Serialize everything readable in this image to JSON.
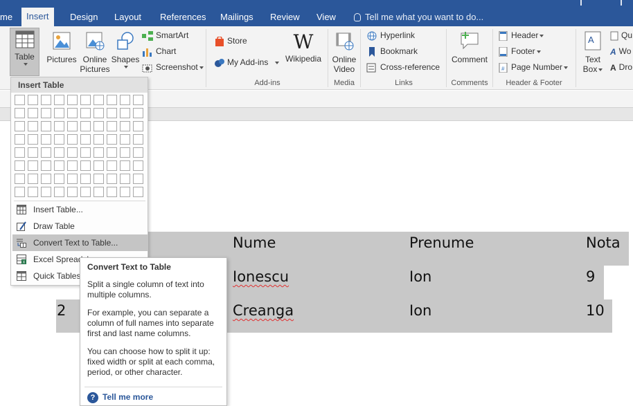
{
  "tabs": [
    {
      "label": "me",
      "active": false
    },
    {
      "label": "Insert",
      "active": true
    },
    {
      "label": "Design",
      "active": false
    },
    {
      "label": "Layout",
      "active": false
    },
    {
      "label": "References",
      "active": false
    },
    {
      "label": "Mailings",
      "active": false
    },
    {
      "label": "Review",
      "active": false
    },
    {
      "label": "View",
      "active": false
    }
  ],
  "tell_me": "Tell me what you want to do...",
  "ribbon": {
    "table": "Table",
    "pictures": "Pictures",
    "online_pictures_1": "Online",
    "online_pictures_2": "Pictures",
    "shapes": "Shapes",
    "smartart": "SmartArt",
    "chart": "Chart",
    "screenshot": "Screenshot",
    "store": "Store",
    "my_addins": "My Add-ins",
    "wikipedia": "Wikipedia",
    "addins_group": "Add-ins",
    "online_video_1": "Online",
    "online_video_2": "Video",
    "media_group": "Media",
    "hyperlink": "Hyperlink",
    "bookmark": "Bookmark",
    "cross_reference": "Cross-reference",
    "links_group": "Links",
    "comment": "Comment",
    "comments_group": "Comments",
    "header": "Header",
    "footer": "Footer",
    "page_number": "Page Number",
    "header_footer_group": "Header & Footer",
    "text_box_1": "Text",
    "text_box_2": "Box",
    "quick_parts": "Qu",
    "wordart": "Wo",
    "dropcap": "Dro"
  },
  "dropdown": {
    "title": "Insert Table",
    "items": [
      {
        "label": "Insert Table...",
        "icon": "table-icon"
      },
      {
        "label": "Draw Table",
        "icon": "pencil-table-icon"
      },
      {
        "label": "Convert Text to Table...",
        "icon": "convert-text-icon"
      },
      {
        "label": "Excel Spreadsh",
        "icon": "excel-icon"
      },
      {
        "label": "Quick Tables",
        "icon": "quick-tables-icon"
      }
    ]
  },
  "tooltip": {
    "title": "Convert Text to Table",
    "p1": "Split a single column of text into multiple columns.",
    "p2": "For example, you can separate a column of full names into separate first and last name columns.",
    "p3": "You can choose how to split it up: fixed width or split at each comma, period, or other character.",
    "more": "Tell me more"
  },
  "document": {
    "headers": [
      "Nume",
      "Prenume",
      "Nota"
    ],
    "rows": [
      {
        "nr": "",
        "nume": "Ionescu",
        "prenume": "Ion",
        "nota": "9"
      },
      {
        "nr": "2",
        "nume": "Creanga",
        "prenume": "Ion",
        "nota": "10"
      }
    ]
  },
  "colors": {
    "accent": "#2b579a",
    "selection": "#c8c8c8"
  }
}
